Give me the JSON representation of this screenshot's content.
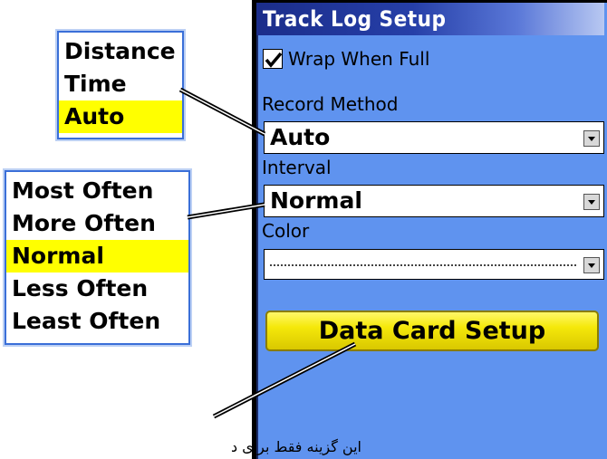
{
  "window": {
    "title": "Track Log Setup"
  },
  "wrap_when_full": {
    "label": "Wrap When Full",
    "checked": true
  },
  "record_method": {
    "label": "Record Method",
    "value": "Auto"
  },
  "interval": {
    "label": "Interval",
    "value": "Normal"
  },
  "color": {
    "label": "Color",
    "value": ""
  },
  "data_card_button": {
    "label": "Data Card Setup"
  },
  "callout_record_method": {
    "options": [
      "Distance",
      "Time",
      "Auto"
    ],
    "selected": "Auto"
  },
  "callout_interval": {
    "options": [
      "Most Often",
      "More Often",
      "Normal",
      "Less Often",
      "Least Often"
    ],
    "selected": "Normal"
  },
  "note": {
    "text": "این گزینه فقط برای دستگاه"
  },
  "colors": {
    "screen_bg": "#5f93ef",
    "titlebar": "#263fa8",
    "highlight": "#ffff00",
    "button": "#f5e80a"
  }
}
